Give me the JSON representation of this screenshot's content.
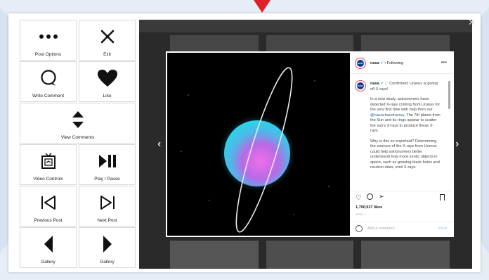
{
  "controls": {
    "post_options": "Post Options",
    "exit": "Exit",
    "write_comment": "Write Comment",
    "like": "Like",
    "view_comments": "View Comments",
    "video_controls": "Video Controls",
    "play_pause": "Play / Pause",
    "previous_post": "Previous Post",
    "next_post": "Next Post",
    "gallery_prev": "Gallery",
    "gallery_next": "Gallery"
  },
  "profile": {
    "username": "nasa",
    "follow_status": "• Following",
    "avatar_text": "NASA"
  },
  "caption": {
    "username": "nasa",
    "headline": "Confirmed: Uranus is giving off X-rays!",
    "p1_before": "In a new study, astronomers have detected X-rays coming from Uranus for the very first time with help from our ",
    "p1_mention": "@nasachandraxray",
    "p1_after": ". The 7th planet from the Sun and its rings appear to scatter the sun's X-rays to produce these X-rays.",
    "p2": "Why is this so important? Determining the sources of the X-rays from Uranus could help astronomers better understand how more exotic objects in space, such as growing black holes and neutron stars, emit X-rays."
  },
  "stats": {
    "likes": "1,790,927 likes",
    "age": "APRIL 1"
  },
  "comment": {
    "placeholder": "Add a comment...",
    "post": "Post"
  },
  "colors": {
    "accent_red": "#e0202a",
    "mention_blue": "#1f5fa8",
    "nasa_blue": "#0b3d91"
  }
}
